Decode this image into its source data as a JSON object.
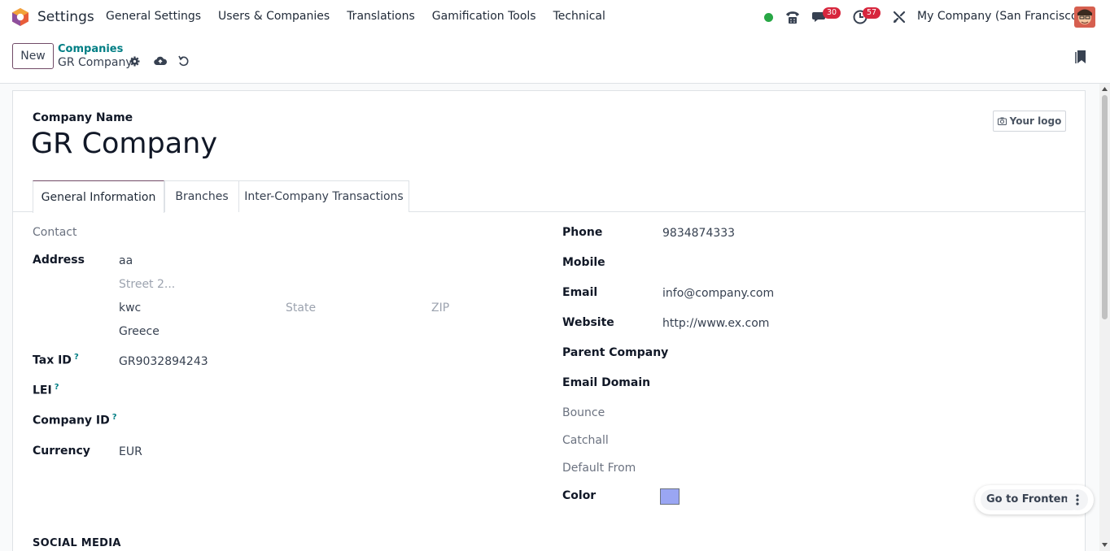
{
  "navbar": {
    "app_name": "Settings",
    "menu": [
      "General Settings",
      "Users & Companies",
      "Translations",
      "Gamification Tools",
      "Technical"
    ],
    "messages_count": "30",
    "activities_count": "57",
    "company": "My Company (San Francisco)",
    "status_color": "#28a745"
  },
  "control": {
    "new_label": "New",
    "breadcrumb_parent": "Companies",
    "breadcrumb_current": "GR Company"
  },
  "form": {
    "company_name_label": "Company Name",
    "company_name": "GR Company",
    "logo_label": "Your logo",
    "tabs": [
      "General Information",
      "Branches",
      "Inter-Company Transactions"
    ],
    "left": {
      "contact": "Contact",
      "address_label": "Address",
      "street": "aa",
      "street2_ph": "Street 2...",
      "city": "kwc",
      "state_ph": "State",
      "zip_ph": "ZIP",
      "country": "Greece",
      "tax_label": "Tax ID",
      "tax_value": "GR9032894243",
      "lei_label": "LEI",
      "company_id_label": "Company ID",
      "currency_label": "Currency",
      "currency_value": "EUR"
    },
    "right": {
      "phone_label": "Phone",
      "phone_value": "9834874333",
      "mobile_label": "Mobile",
      "email_label": "Email",
      "email_value": "info@company.com",
      "website_label": "Website",
      "website_value": "http://www.ex.com",
      "parent_label": "Parent Company",
      "domain_label": "Email Domain",
      "bounce_label": "Bounce",
      "catchall_label": "Catchall",
      "default_from_label": "Default From",
      "color_label": "Color",
      "color_value": "#9aa6f3"
    },
    "social_section": "SOCIAL MEDIA",
    "help_mark": "?"
  },
  "frontend": {
    "label": "Go to Frontend"
  }
}
